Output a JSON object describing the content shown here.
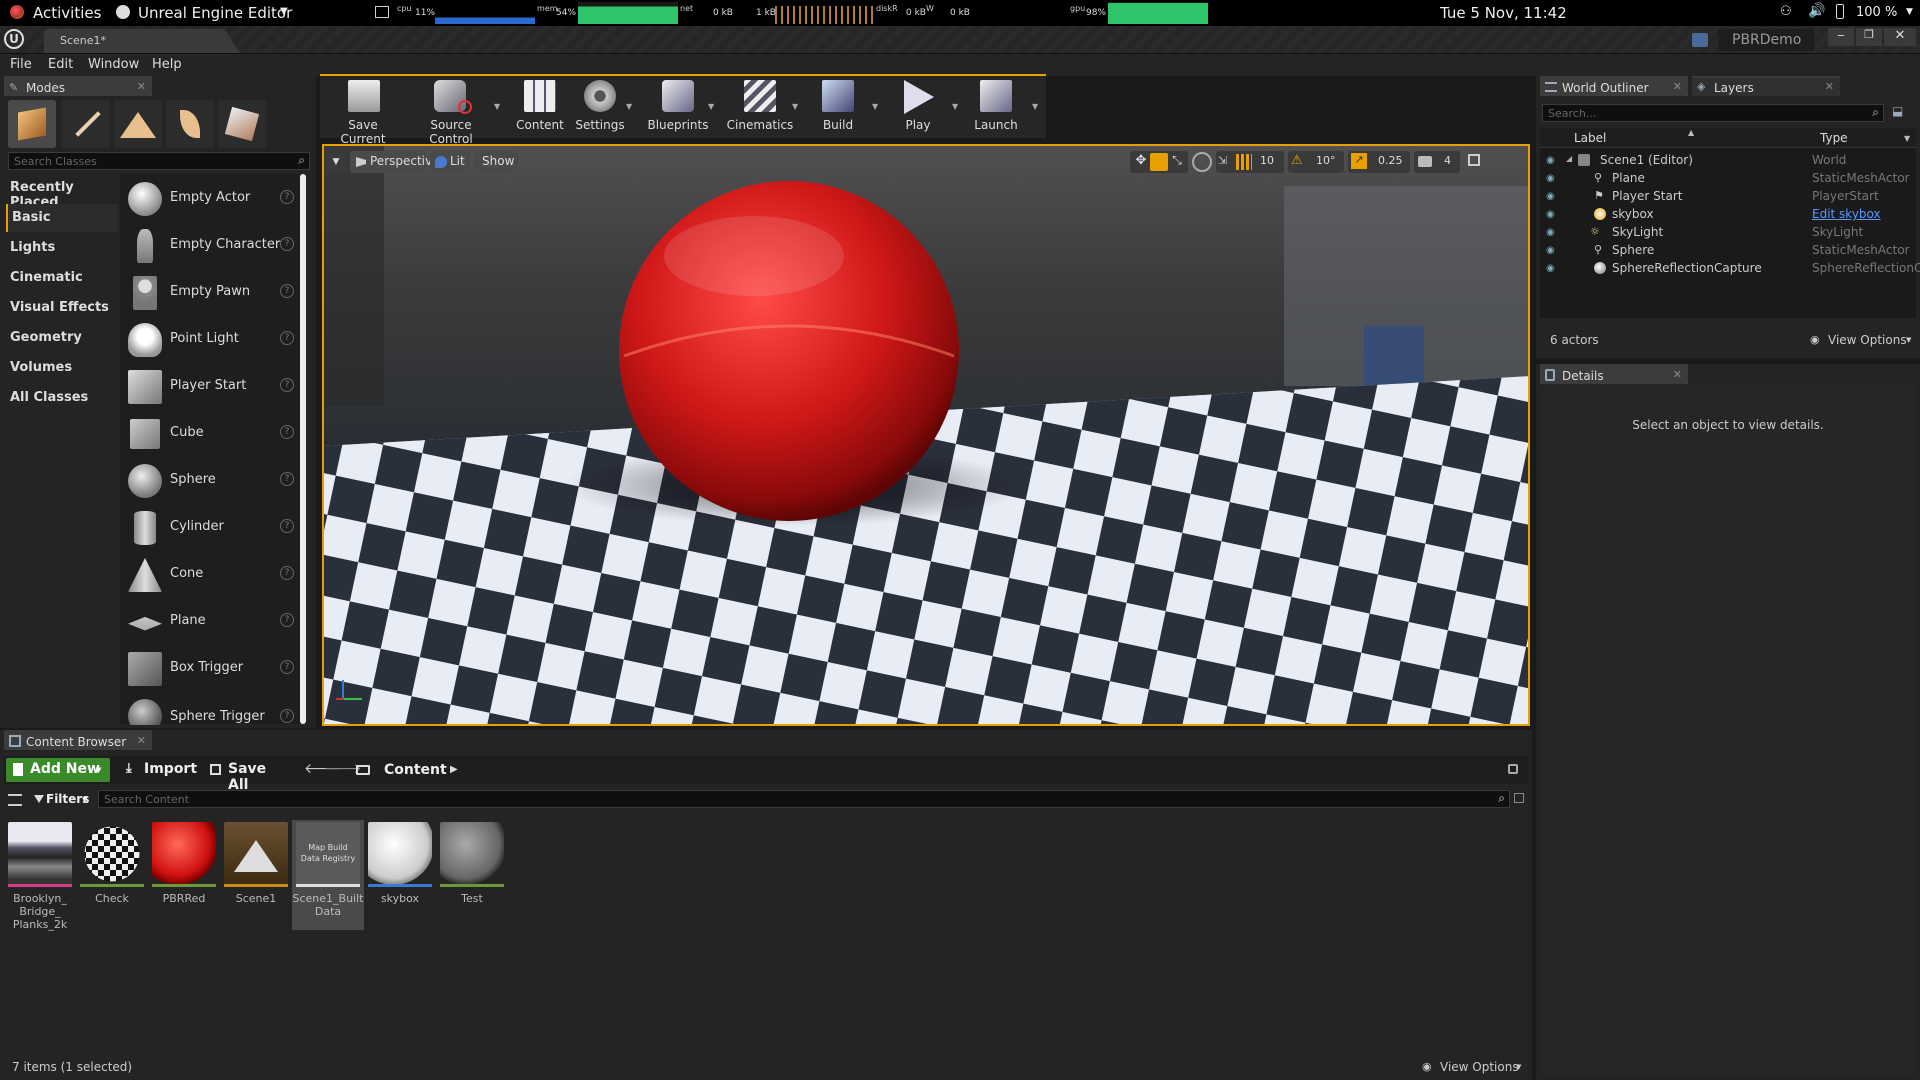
{
  "topbar": {
    "activities": "Activities",
    "app_menu": "Unreal Engine Editor",
    "monitors": {
      "cpu_label": "cpu",
      "cpu_value": "11%",
      "mem_label": "mem",
      "mem_value": "54%",
      "net_label": "net",
      "net_in": "0 kB",
      "net_out": "1 kB",
      "disk_label": "diskR",
      "disk_read": "0 kB",
      "disk_write_label": "W",
      "disk_write": "0 kB",
      "gpu_label": "gpu",
      "gpu_value": "98%"
    },
    "clock": "Tue  5 Nov, 11:42",
    "battery": "100 %"
  },
  "window": {
    "tab": "Scene1*",
    "project": "PBRDemo"
  },
  "menu": [
    "File",
    "Edit",
    "Window",
    "Help"
  ],
  "modes": {
    "tab": "Modes",
    "search_placeholder": "Search Classes",
    "categories": [
      "Recently Placed",
      "Basic",
      "Lights",
      "Cinematic",
      "Visual Effects",
      "Geometry",
      "Volumes",
      "All Classes"
    ],
    "selected_category": "Basic",
    "items": [
      "Empty Actor",
      "Empty Character",
      "Empty Pawn",
      "Point Light",
      "Player Start",
      "Cube",
      "Sphere",
      "Cylinder",
      "Cone",
      "Plane",
      "Box Trigger",
      "Sphere Trigger"
    ]
  },
  "toolbar": {
    "buttons": [
      "Save Current",
      "Source Control",
      "Content",
      "Settings",
      "Blueprints",
      "Cinematics",
      "Build",
      "Play",
      "Launch"
    ]
  },
  "viewport": {
    "perspective": "Perspective",
    "lit": "Lit",
    "show": "Show",
    "grid_snap": "10",
    "rot_snap": "10°",
    "scale_snap": "0.25",
    "camera_speed": "4",
    "accent_color": "#e8a000"
  },
  "outliner": {
    "tab": "World Outliner",
    "layers_tab": "Layers",
    "search_placeholder": "Search...",
    "col_label": "Label",
    "col_type": "Type",
    "rows": [
      {
        "label": "Scene1 (Editor)",
        "type": "World"
      },
      {
        "label": "Plane",
        "type": "StaticMeshActor"
      },
      {
        "label": "Player Start",
        "type": "PlayerStart"
      },
      {
        "label": "skybox",
        "type": "Edit skybox"
      },
      {
        "label": "SkyLight",
        "type": "SkyLight"
      },
      {
        "label": "Sphere",
        "type": "StaticMeshActor"
      },
      {
        "label": "SphereReflectionCapture",
        "type": "SphereReflectionC"
      }
    ],
    "count": "6 actors",
    "view_options": "View Options"
  },
  "details": {
    "tab": "Details",
    "empty_text": "Select an object to view details."
  },
  "content_browser": {
    "tab": "Content Browser",
    "add_new": "Add New",
    "import": "Import",
    "save_all": "Save All",
    "path": "Content",
    "filters": "Filters",
    "search_placeholder": "Search Content",
    "assets": [
      {
        "name": "Brooklyn_Bridge_Planks_2k",
        "line1": "Brooklyn_",
        "line2": "Bridge_",
        "line3": "Planks_2k",
        "bar": "#d0408a"
      },
      {
        "name": "Check",
        "line1": "Check",
        "line2": "",
        "line3": "",
        "bar": "#6a9a3a"
      },
      {
        "name": "PBRRed",
        "line1": "PBRRed",
        "line2": "",
        "line3": "",
        "bar": "#6a9a3a"
      },
      {
        "name": "Scene1",
        "line1": "Scene1",
        "line2": "",
        "line3": "",
        "bar": "#d08a1a"
      },
      {
        "name": "Scene1_BuiltData",
        "line1": "Scene1_Built",
        "line2": "Data",
        "line3": "",
        "bar": "#dddddd",
        "thumb_text": "Map Build Data Registry"
      },
      {
        "name": "skybox",
        "line1": "skybox",
        "line2": "",
        "line3": "",
        "bar": "#3a7ad0"
      },
      {
        "name": "Test",
        "line1": "Test",
        "line2": "",
        "line3": "",
        "bar": "#6a9a3a"
      }
    ],
    "status": "7 items (1 selected)",
    "view_options": "View Options"
  }
}
